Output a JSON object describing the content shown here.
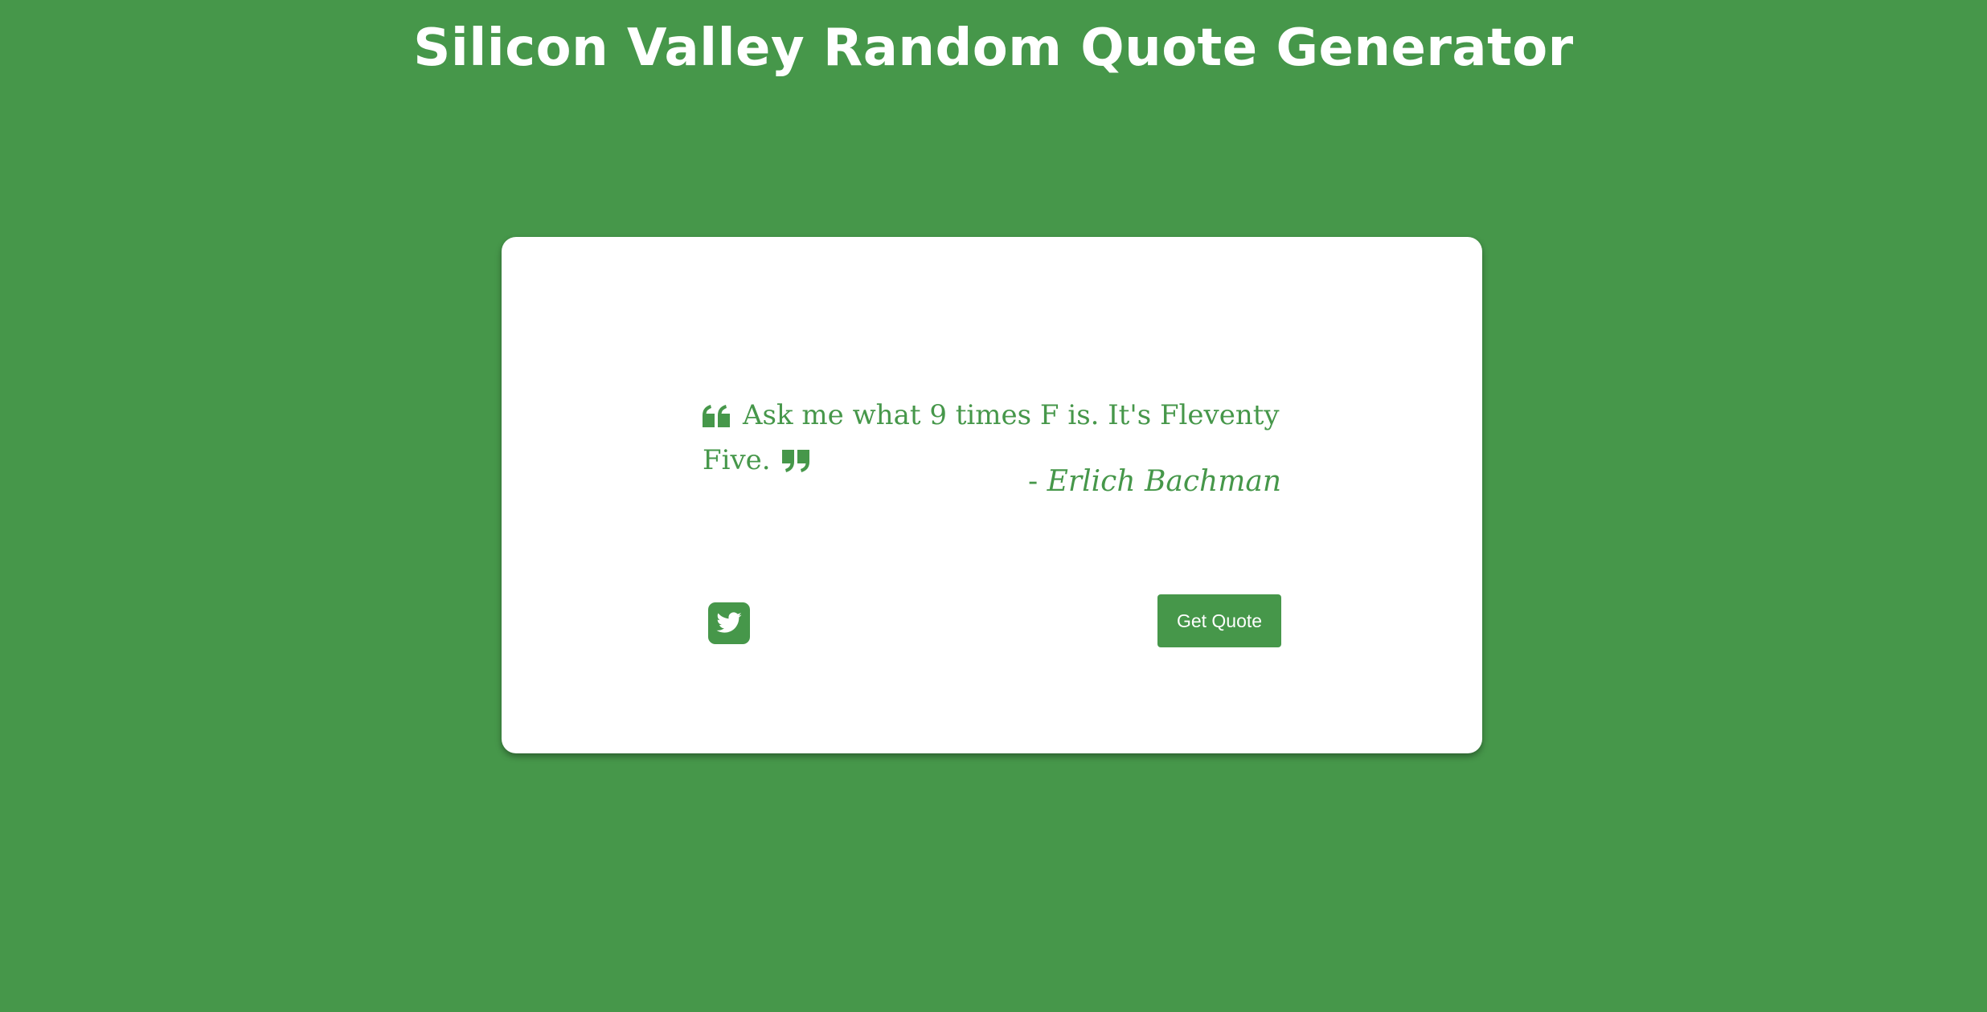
{
  "page": {
    "title": "Silicon Valley Random Quote Generator",
    "background_color": "#46974a"
  },
  "quote": {
    "text": "Ask me what 9 times F is. It's Fleventy Five.",
    "author_prefix": "- ",
    "author": "Erlich Bachman",
    "open_icon": "quote-left-icon",
    "close_icon": "quote-right-icon",
    "text_color": "#46974a"
  },
  "actions": {
    "tweet_icon": "twitter-icon",
    "get_quote_label": "Get Quote",
    "accent_color": "#46974a"
  }
}
